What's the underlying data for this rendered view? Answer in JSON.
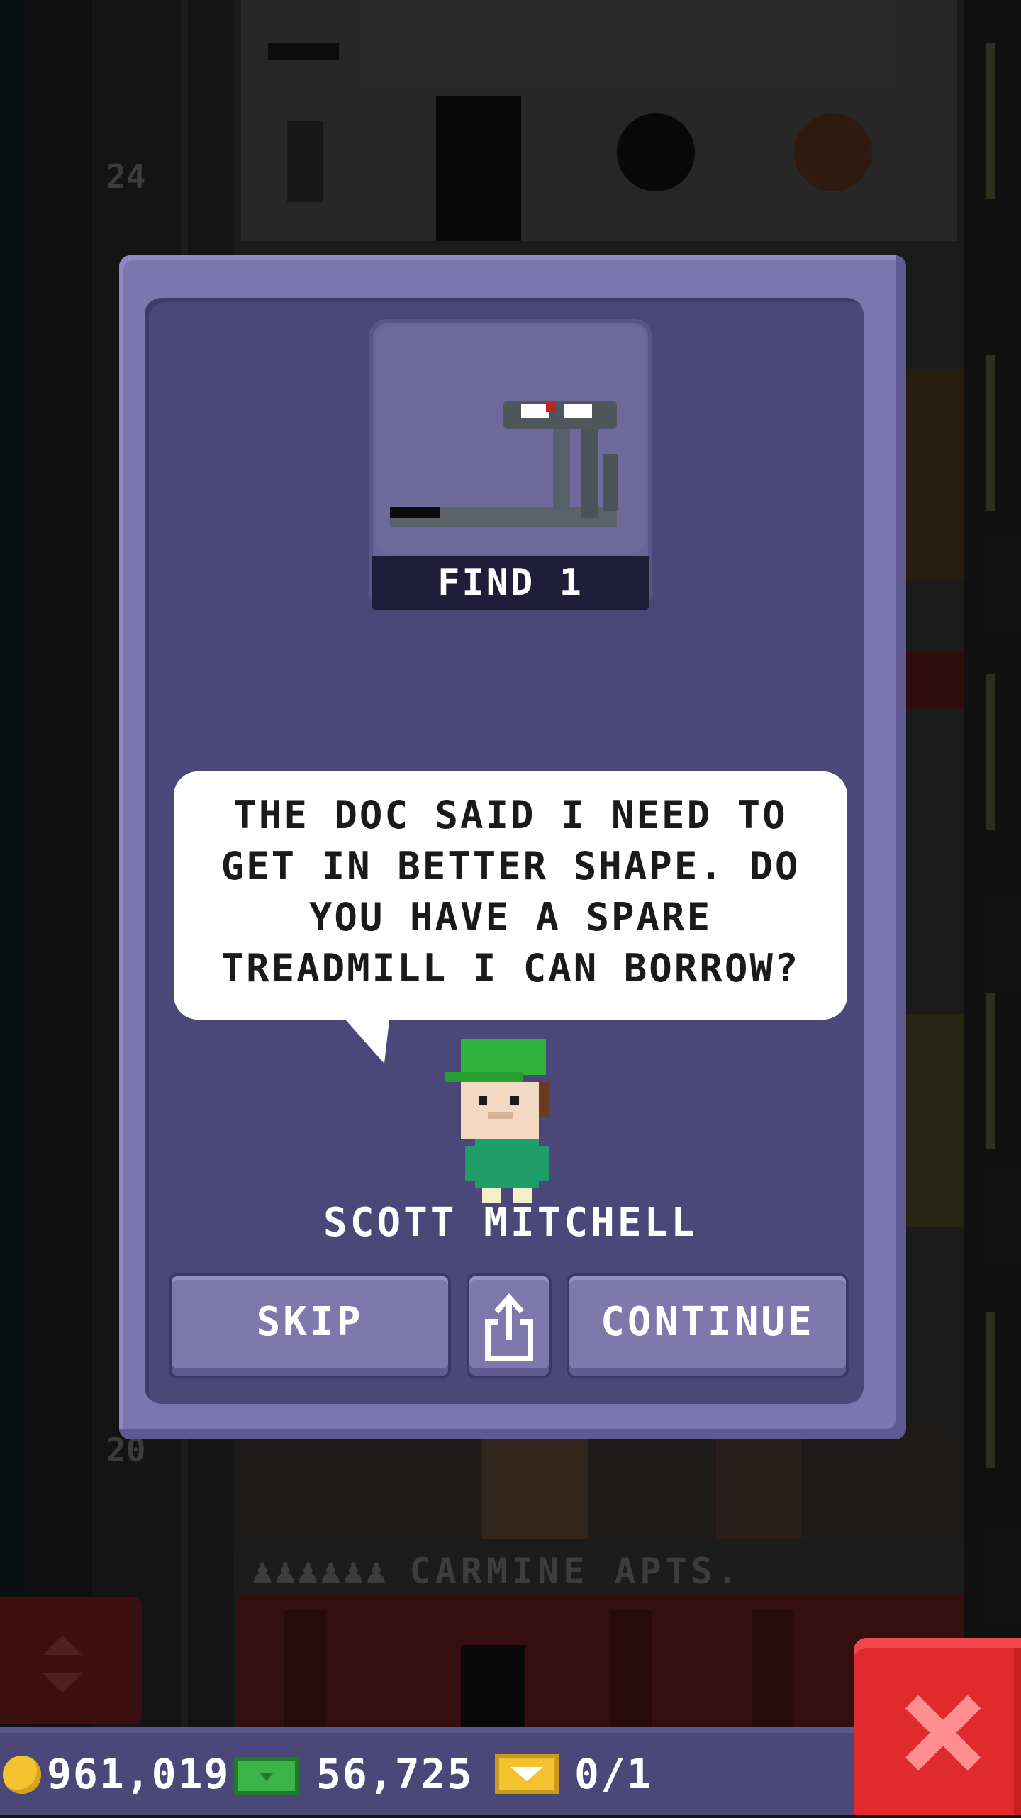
{
  "background": {
    "floor_numbers": [
      "24",
      "20"
    ],
    "floor_name_banner": "CARMINE APTS.",
    "banner_people_icons": "♟♟♟♟♟♟"
  },
  "modal": {
    "item_label": "FIND 1",
    "item_icon": "treadmill-icon",
    "dialogue": "THE DOC SAID I NEED TO GET IN BETTER SHAPE. DO YOU HAVE A SPARE TREADMILL I CAN BORROW?",
    "character_name": "SCOTT MITCHELL",
    "buttons": {
      "skip_label": "SKIP",
      "share_icon": "share-icon",
      "continue_label": "CONTINUE"
    }
  },
  "status_bar": {
    "coins": "961,019",
    "bux": "56,725",
    "vip": "0/1"
  },
  "colors": {
    "modal_frame": "#7c75b0",
    "modal_body": "#4b4778",
    "button": "#7e78ad",
    "close_button": "#e02a2e",
    "coin": "#f4c430",
    "bux": "#3bb54a",
    "vip": "#f2c230"
  }
}
